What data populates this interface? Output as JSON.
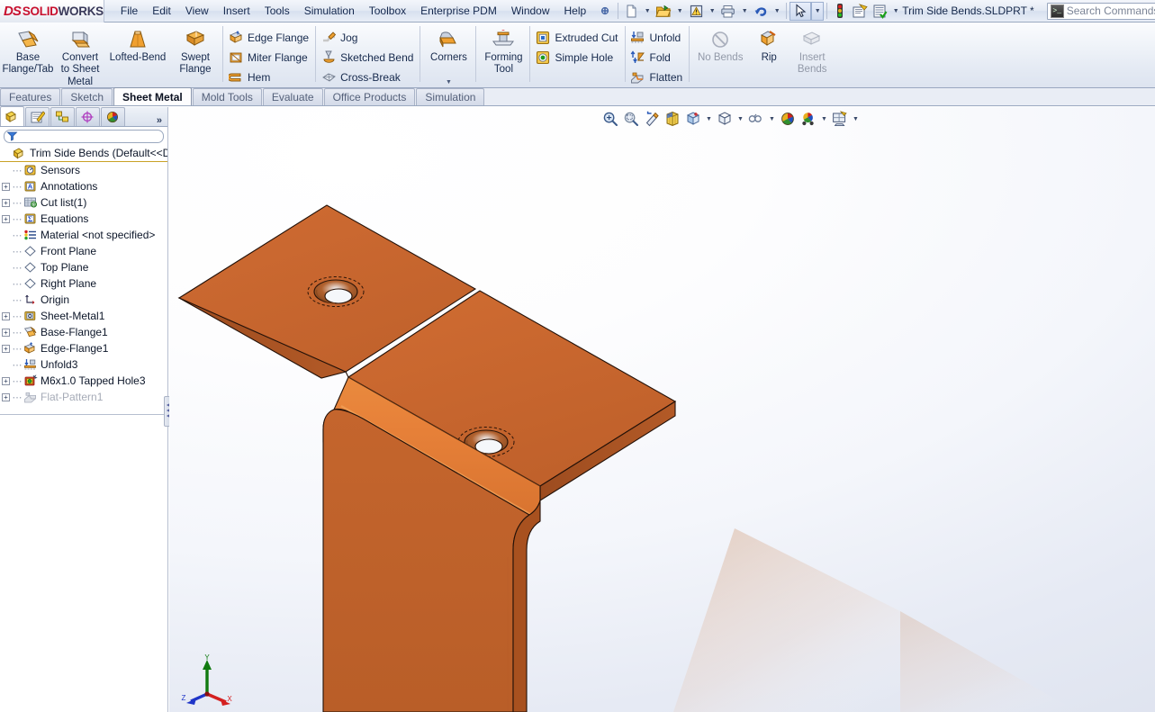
{
  "app": {
    "brand_ds": "DS",
    "brand_solid": "SOLID",
    "brand_works": "WORKS",
    "document_title": "Trim Side Bends.SLDPRT *"
  },
  "menubar": {
    "items": [
      {
        "label": "File"
      },
      {
        "label": "Edit"
      },
      {
        "label": "View"
      },
      {
        "label": "Insert"
      },
      {
        "label": "Tools"
      },
      {
        "label": "Simulation"
      },
      {
        "label": "Toolbox"
      },
      {
        "label": "Enterprise PDM"
      },
      {
        "label": "Window"
      },
      {
        "label": "Help"
      }
    ],
    "icons": [
      {
        "name": "pin-icon"
      },
      {
        "name": "new-document-icon"
      },
      {
        "name": "open-folder-icon"
      },
      {
        "name": "save-icon"
      },
      {
        "name": "print-icon"
      },
      {
        "name": "undo-icon"
      },
      {
        "name": "select-arrow-icon"
      },
      {
        "name": "rebuild-icon"
      },
      {
        "name": "options-icon"
      },
      {
        "name": "customize-icon"
      }
    ]
  },
  "search": {
    "placeholder": "Search Commands",
    "icon": "search-commands-icon"
  },
  "ribbon": {
    "groups": [
      {
        "name": "base-group",
        "buttons": [
          {
            "label": "Base\nFlange/Tab",
            "label_l1": "Base",
            "label_l2": "Flange/Tab",
            "icon": "base-flange-icon"
          },
          {
            "label": "Convert to Sheet Metal",
            "label_l1": "Convert",
            "label_l2": "to Sheet",
            "label_l3": "Metal",
            "icon": "convert-sheet-metal-icon"
          },
          {
            "label": "Lofted-Bend",
            "label_l1": "Lofted-Bend",
            "icon": "lofted-bend-icon"
          },
          {
            "label": "Swept Flange",
            "label_l1": "Swept",
            "label_l2": "Flange",
            "icon": "swept-flange-icon"
          }
        ]
      },
      {
        "name": "flange-group",
        "buttons": [
          {
            "label": "Edge Flange",
            "icon": "edge-flange-icon"
          },
          {
            "label": "Miter Flange",
            "icon": "miter-flange-icon"
          },
          {
            "label": "Hem",
            "icon": "hem-icon"
          }
        ]
      },
      {
        "name": "bend-group",
        "buttons": [
          {
            "label": "Jog",
            "icon": "jog-icon"
          },
          {
            "label": "Sketched Bend",
            "icon": "sketched-bend-icon"
          },
          {
            "label": "Cross-Break",
            "icon": "cross-break-icon"
          }
        ]
      },
      {
        "name": "corners-group",
        "buttons": [
          {
            "label": "Corners",
            "icon": "corners-icon"
          }
        ]
      },
      {
        "name": "forming-group",
        "buttons": [
          {
            "label": "Forming Tool",
            "label_l1": "Forming",
            "label_l2": "Tool",
            "icon": "forming-tool-icon"
          }
        ]
      },
      {
        "name": "cut-group",
        "buttons": [
          {
            "label": "Extruded Cut",
            "icon": "extruded-cut-icon"
          },
          {
            "label": "Simple Hole",
            "icon": "simple-hole-icon"
          }
        ]
      },
      {
        "name": "flatten-group",
        "buttons": [
          {
            "label": "Unfold",
            "icon": "unfold-icon"
          },
          {
            "label": "Fold",
            "icon": "fold-icon"
          },
          {
            "label": "Flatten",
            "icon": "flatten-icon"
          }
        ]
      },
      {
        "name": "bends-group",
        "buttons": [
          {
            "label": "No Bends",
            "icon": "no-bends-icon",
            "disabled": true
          },
          {
            "label": "Rip",
            "icon": "rip-icon"
          },
          {
            "label": "Insert Bends",
            "label_l1": "Insert",
            "label_l2": "Bends",
            "icon": "insert-bends-icon",
            "disabled": true
          }
        ]
      }
    ]
  },
  "command_tabs": {
    "active": "Sheet Metal",
    "tabs": [
      {
        "label": "Features"
      },
      {
        "label": "Sketch"
      },
      {
        "label": "Sheet Metal"
      },
      {
        "label": "Mold Tools"
      },
      {
        "label": "Evaluate"
      },
      {
        "label": "Office Products"
      },
      {
        "label": "Simulation"
      }
    ]
  },
  "panel": {
    "tabs": [
      {
        "name": "feature-manager-tab",
        "active": true
      },
      {
        "name": "property-manager-tab",
        "active": false
      },
      {
        "name": "configuration-manager-tab",
        "active": false
      },
      {
        "name": "dimxpert-manager-tab",
        "active": false
      },
      {
        "name": "display-manager-tab",
        "active": false
      }
    ],
    "more_label": "»",
    "filter_placeholder": "",
    "tree": {
      "root": {
        "label": "Trim Side Bends  (Default<<De",
        "icon": "part-icon"
      },
      "items": [
        {
          "label": "Sensors",
          "icon": "sensors-icon",
          "expandable": false,
          "indent": 1
        },
        {
          "label": "Annotations",
          "icon": "annotations-icon",
          "expandable": true,
          "indent": 1
        },
        {
          "label": "Cut list(1)",
          "icon": "cut-list-icon",
          "expandable": true,
          "indent": 1
        },
        {
          "label": "Equations",
          "icon": "equations-icon",
          "expandable": true,
          "indent": 1
        },
        {
          "label": "Material <not specified>",
          "icon": "material-icon",
          "expandable": false,
          "indent": 1
        },
        {
          "label": "Front Plane",
          "icon": "plane-icon",
          "expandable": false,
          "indent": 1
        },
        {
          "label": "Top Plane",
          "icon": "plane-icon",
          "expandable": false,
          "indent": 1
        },
        {
          "label": "Right Plane",
          "icon": "plane-icon",
          "expandable": false,
          "indent": 1
        },
        {
          "label": "Origin",
          "icon": "origin-icon",
          "expandable": false,
          "indent": 1
        },
        {
          "label": "Sheet-Metal1",
          "icon": "sheet-metal-icon",
          "expandable": true,
          "indent": 1
        },
        {
          "label": "Base-Flange1",
          "icon": "base-flange-icon",
          "expandable": true,
          "indent": 1
        },
        {
          "label": "Edge-Flange1",
          "icon": "edge-flange-icon",
          "expandable": true,
          "indent": 1
        },
        {
          "label": "Unfold3",
          "icon": "unfold-icon",
          "expandable": false,
          "indent": 1
        },
        {
          "label": "M6x1.0 Tapped Hole3",
          "icon": "hole-wizard-icon",
          "expandable": true,
          "indent": 1
        },
        {
          "label": "Flat-Pattern1",
          "icon": "flat-pattern-icon",
          "expandable": true,
          "indent": 1,
          "greyed": true
        }
      ]
    }
  },
  "view_toolbar": {
    "buttons": [
      {
        "name": "zoom-to-fit-icon"
      },
      {
        "name": "zoom-to-area-icon"
      },
      {
        "name": "previous-view-icon"
      },
      {
        "name": "section-view-icon"
      },
      {
        "name": "view-orientation-icon",
        "has_dropdown": true
      },
      {
        "name": "display-style-icon",
        "has_dropdown": true
      },
      {
        "name": "hide-show-items-icon",
        "has_dropdown": true
      },
      {
        "name": "apply-scene-icon"
      },
      {
        "name": "view-settings-icon",
        "has_dropdown": true
      },
      {
        "name": "viewport-icon",
        "has_dropdown": true
      }
    ]
  },
  "triad": {
    "x_label": "X",
    "y_label": "Y",
    "z_label": "Z",
    "x_color": "#d42020",
    "y_color": "#107a10",
    "z_color": "#1f35c8"
  },
  "model": {
    "name": "sheet-metal-bracket",
    "face_color": "#c8652f",
    "face_light": "#e0762f",
    "face_dark": "#a04f22",
    "edge_color": "#241208"
  }
}
